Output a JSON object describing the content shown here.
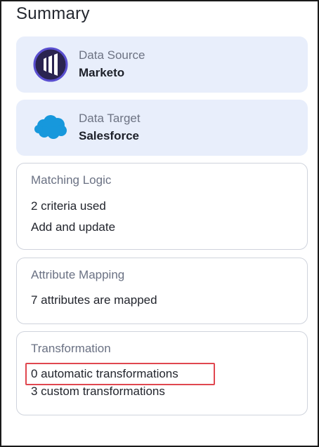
{
  "summary": {
    "title": "Summary"
  },
  "data_source": {
    "label": "Data Source",
    "value": "Marketo",
    "icon": "marketo-logo-icon",
    "icon_color": "#2a2450"
  },
  "data_target": {
    "label": "Data Target",
    "value": "Salesforce",
    "icon": "salesforce-cloud-icon",
    "icon_color": "#1798dc"
  },
  "matching_logic": {
    "title": "Matching Logic",
    "lines": [
      "2 criteria used",
      "Add and update"
    ]
  },
  "attribute_mapping": {
    "title": "Attribute Mapping",
    "lines": [
      "7 attributes are mapped"
    ]
  },
  "transformation": {
    "title": "Transformation",
    "lines": [
      "0 automatic transformations",
      "3 custom transformations"
    ],
    "highlight_color": "#e0474f"
  }
}
